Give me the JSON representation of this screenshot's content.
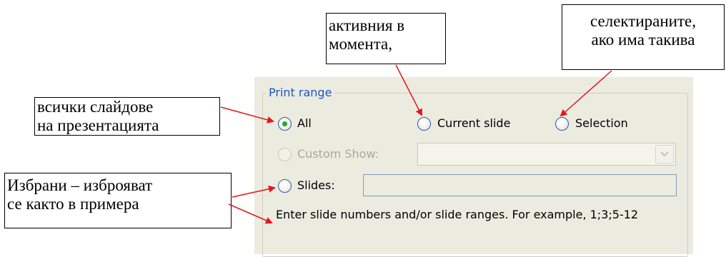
{
  "print_range": {
    "legend": "Print range",
    "all_label": "All",
    "all_checked": true,
    "current_slide_label": "Current slide",
    "selection_label": "Selection",
    "custom_show_label": "Custom Show:",
    "custom_show_value": "",
    "slides_label": "Slides:",
    "slides_value": "",
    "help_text": "Enter slide numbers and/or slide ranges. For example, 1;3;5-12"
  },
  "callouts": {
    "all_slides": [
      "всички слайдове",
      "на презентацията"
    ],
    "current": [
      "активния в",
      "момента,"
    ],
    "selection": [
      "селектираните,",
      "ако има такива"
    ],
    "slides": [
      "Избрани – изброяват",
      "се както в примера"
    ]
  },
  "colors": {
    "accent_blue": "#1f56c3",
    "radio_border": "#2d5bb0",
    "radio_dot": "#2ba52b",
    "arrow_red": "#e8141c",
    "panel_bg": "#ecebe0"
  }
}
